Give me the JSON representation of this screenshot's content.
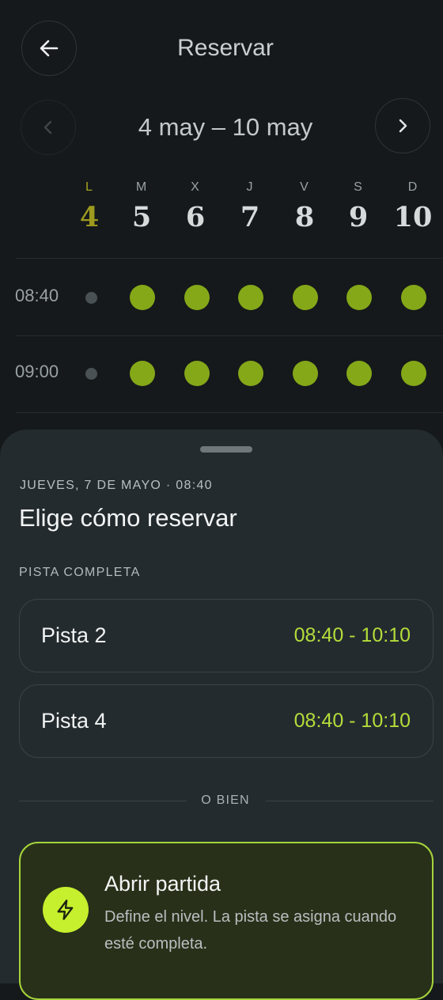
{
  "header": {
    "title": "Reservar"
  },
  "week": {
    "range": "4 may – 10 may",
    "days": [
      {
        "abbr": "L",
        "num": "4"
      },
      {
        "abbr": "M",
        "num": "5"
      },
      {
        "abbr": "X",
        "num": "6"
      },
      {
        "abbr": "J",
        "num": "7"
      },
      {
        "abbr": "V",
        "num": "8"
      },
      {
        "abbr": "S",
        "num": "9"
      },
      {
        "abbr": "D",
        "num": "10"
      }
    ]
  },
  "slots": [
    {
      "time": "08:40"
    },
    {
      "time": "09:00"
    }
  ],
  "sheet": {
    "date_line": "JUEVES, 7 DE MAYO · 08:40",
    "heading": "Elige cómo reservar",
    "section_label": "PISTA COMPLETA",
    "courts": [
      {
        "name": "Pista 2",
        "hours": "08:40 - 10:10"
      },
      {
        "name": "Pista 4",
        "hours": "08:40 - 10:10"
      }
    ],
    "or_label": "O BIEN",
    "open_match": {
      "title": "Abrir partida",
      "description": "Define el nivel. La pista se asigna cuando esté completa."
    }
  },
  "colors": {
    "accent": "#b4dd3a",
    "slot_available": "#85a818",
    "background": "#15191b",
    "sheet": "#242b2f"
  }
}
